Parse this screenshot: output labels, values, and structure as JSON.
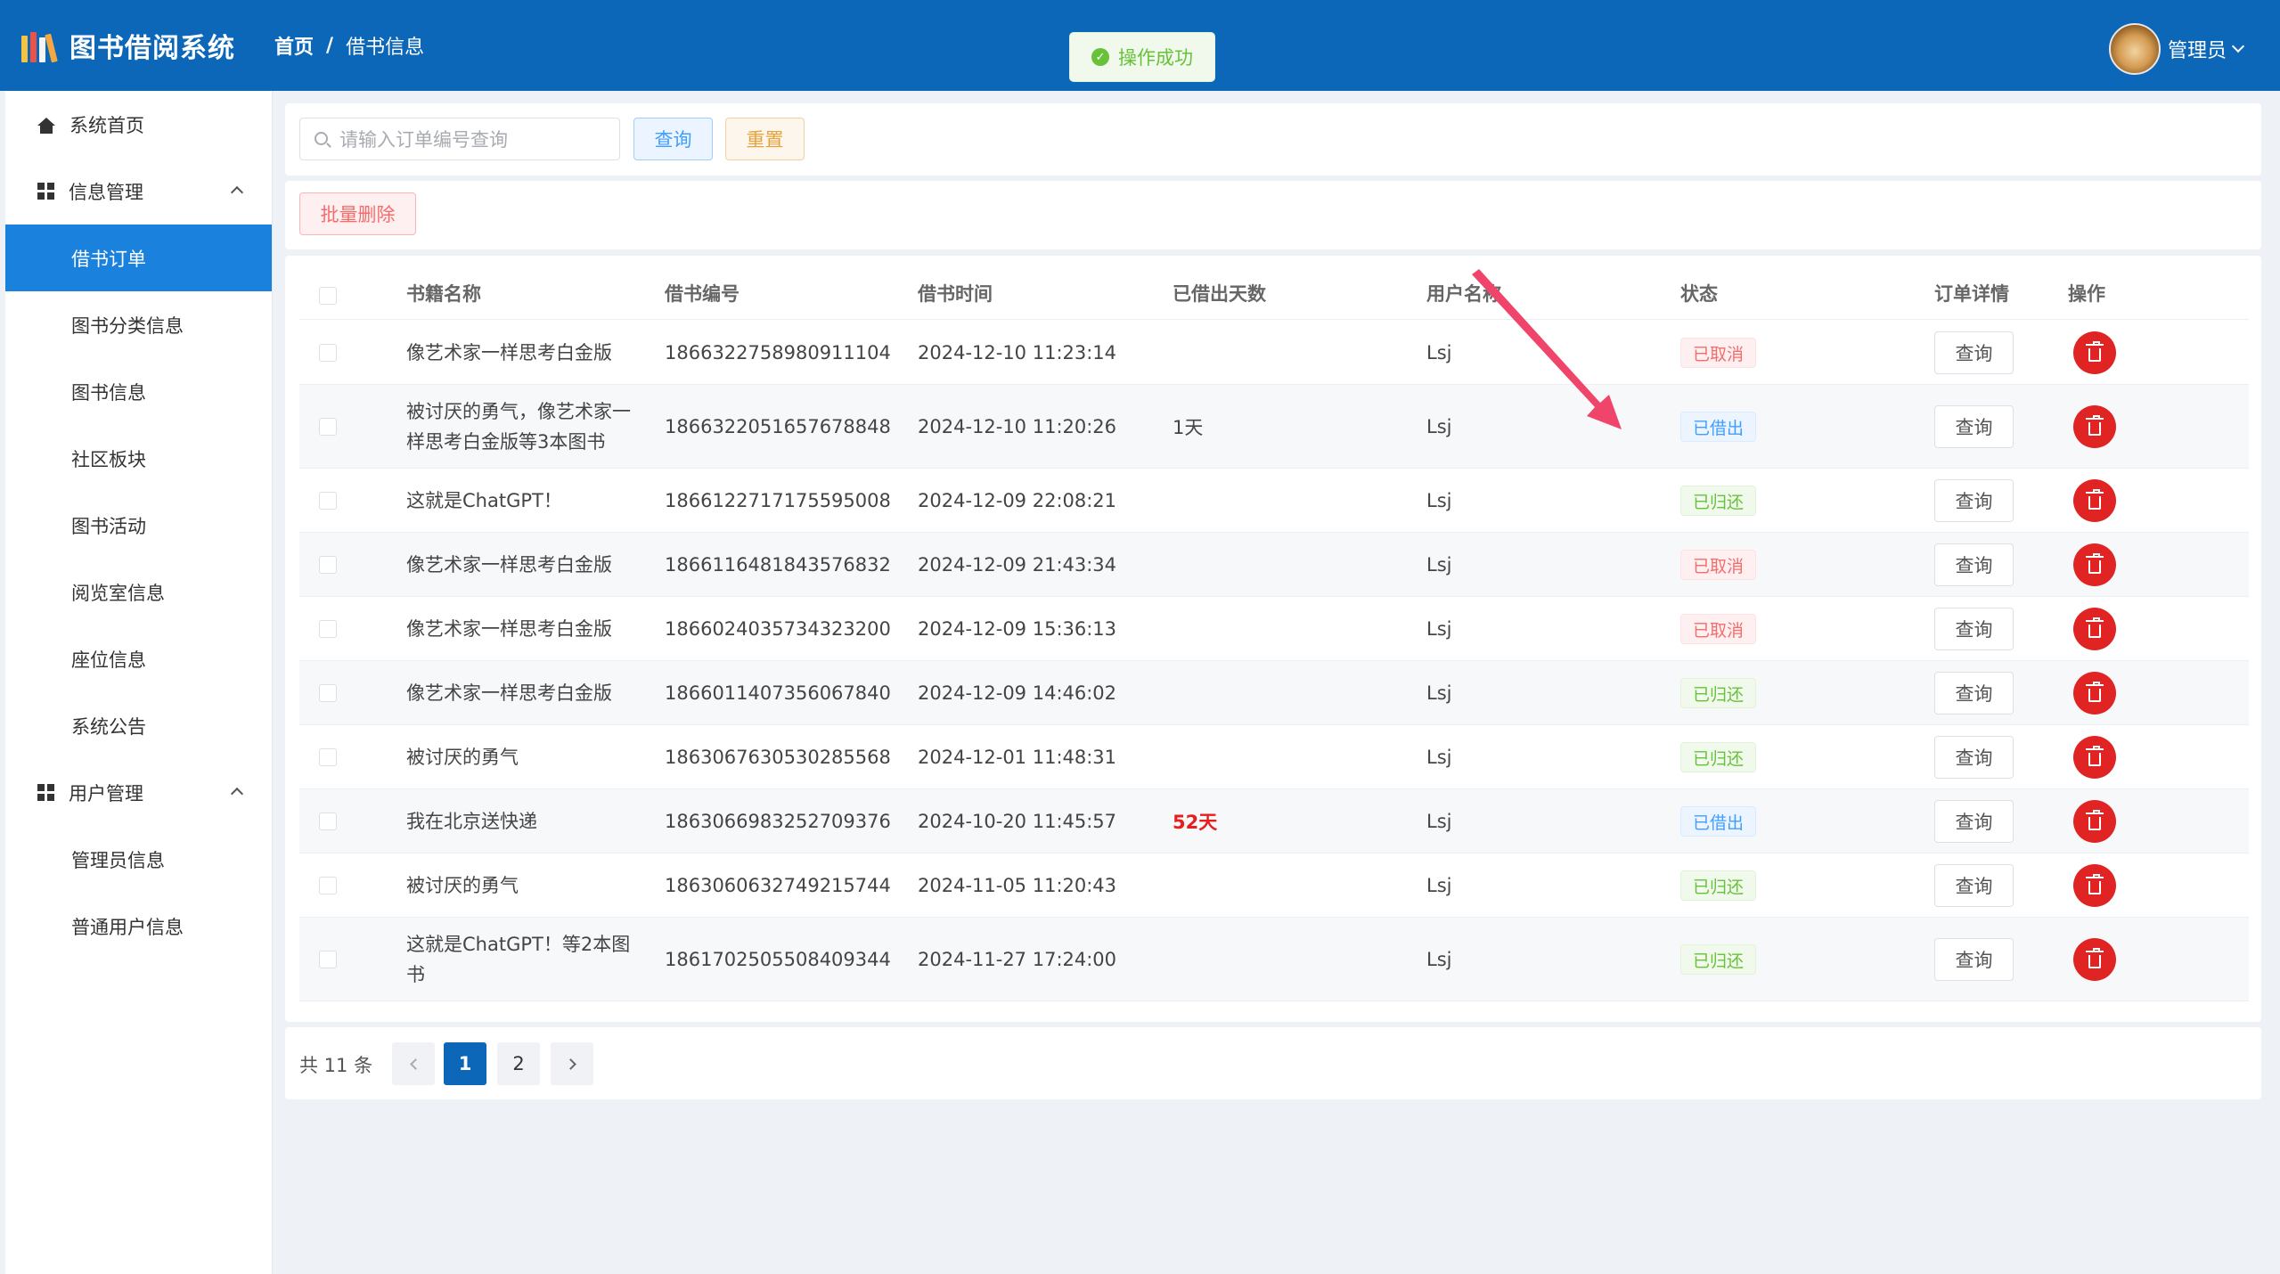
{
  "app": {
    "title": "图书借阅系统"
  },
  "breadcrumb": {
    "home": "首页",
    "separator": "/",
    "current": "借书信息"
  },
  "toast": {
    "text": "操作成功"
  },
  "user": {
    "name": "管理员"
  },
  "sidebar": {
    "home": "系统首页",
    "info_group": "信息管理",
    "info_items": [
      "借书订单",
      "图书分类信息",
      "图书信息",
      "社区板块",
      "图书活动",
      "阅览室信息",
      "座位信息",
      "系统公告"
    ],
    "user_group": "用户管理",
    "user_items": [
      "管理员信息",
      "普通用户信息"
    ]
  },
  "search": {
    "placeholder": "请输入订单编号查询",
    "query_label": "查询",
    "reset_label": "重置"
  },
  "toolbar": {
    "batch_delete_label": "批量删除"
  },
  "table": {
    "headers": [
      "书籍名称",
      "借书编号",
      "借书时间",
      "已借出天数",
      "用户名称",
      "状态",
      "订单详情",
      "操作"
    ],
    "detail_label": "查询",
    "rows": [
      {
        "book": "像艺术家一样思考白金版",
        "no": "1866322758980911104",
        "time": "2024-12-10 11:23:14",
        "days": "",
        "user": "Lsj",
        "status": "已取消"
      },
      {
        "book": "被讨厌的勇气，像艺术家一样思考白金版等3本图书",
        "no": "1866322051657678848",
        "time": "2024-12-10 11:20:26",
        "days": "1天",
        "user": "Lsj",
        "status": "已借出"
      },
      {
        "book": "这就是ChatGPT！",
        "no": "1866122717175595008",
        "time": "2024-12-09 22:08:21",
        "days": "",
        "user": "Lsj",
        "status": "已归还"
      },
      {
        "book": "像艺术家一样思考白金版",
        "no": "1866116481843576832",
        "time": "2024-12-09 21:43:34",
        "days": "",
        "user": "Lsj",
        "status": "已取消"
      },
      {
        "book": "像艺术家一样思考白金版",
        "no": "1866024035734323200",
        "time": "2024-12-09 15:36:13",
        "days": "",
        "user": "Lsj",
        "status": "已取消"
      },
      {
        "book": "像艺术家一样思考白金版",
        "no": "1866011407356067840",
        "time": "2024-12-09 14:46:02",
        "days": "",
        "user": "Lsj",
        "status": "已归还"
      },
      {
        "book": "被讨厌的勇气",
        "no": "1863067630530285568",
        "time": "2024-12-01 11:48:31",
        "days": "",
        "user": "Lsj",
        "status": "已归还"
      },
      {
        "book": "我在北京送快递",
        "no": "1863066983252709376",
        "time": "2024-10-20 11:45:57",
        "days": "52天",
        "user": "Lsj",
        "status": "已借出"
      },
      {
        "book": "被讨厌的勇气",
        "no": "1863060632749215744",
        "time": "2024-11-05 11:20:43",
        "days": "",
        "user": "Lsj",
        "status": "已归还"
      },
      {
        "book": "这就是ChatGPT！等2本图书",
        "no": "1861702505508409344",
        "time": "2024-11-27 17:24:00",
        "days": "",
        "user": "Lsj",
        "status": "已归还"
      }
    ]
  },
  "pagination": {
    "total": "共 11 条",
    "pages": [
      "1",
      "2"
    ],
    "current": "1"
  },
  "colors": {
    "header": "#0c67b8",
    "active_menu": "#1a82dd",
    "danger": "#e02424",
    "annotation_arrow": "#f0456a"
  }
}
